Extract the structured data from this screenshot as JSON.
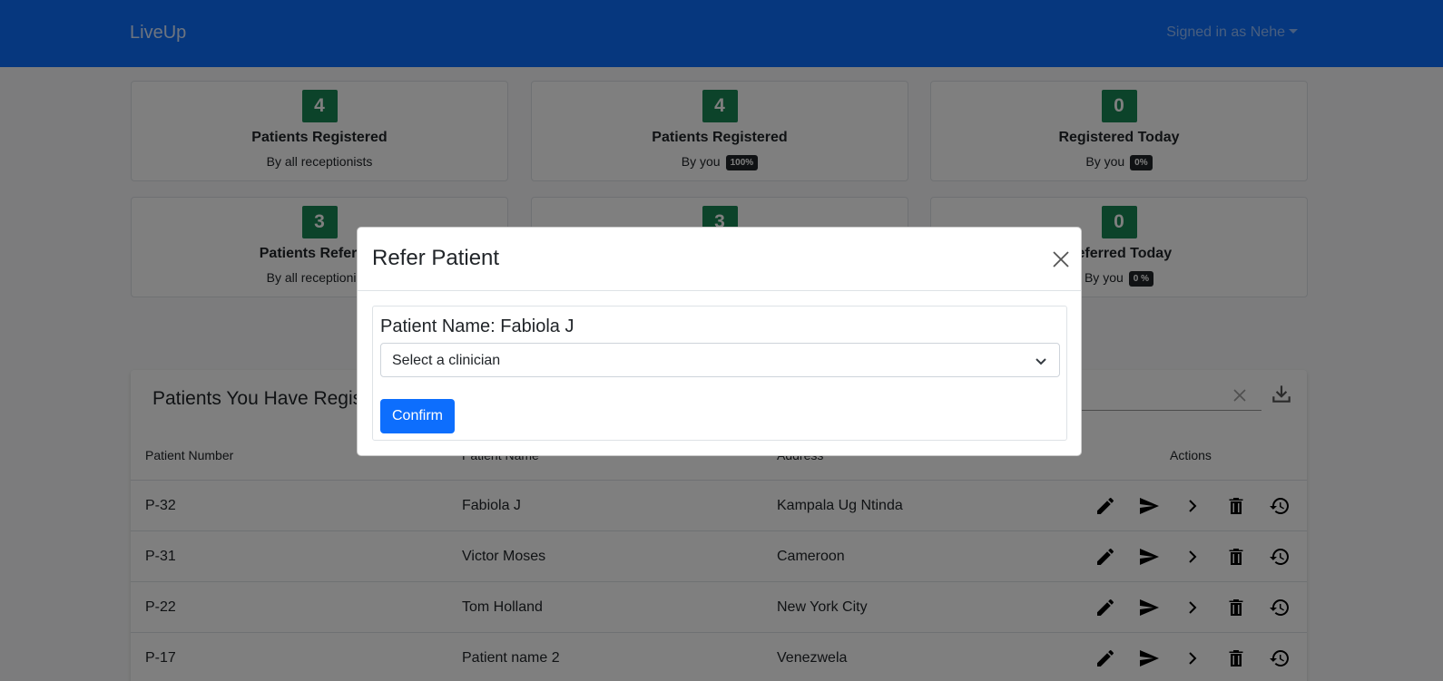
{
  "navbar": {
    "brand": "LiveUp",
    "user": "Signed in as Nehe"
  },
  "stats": [
    {
      "count": "4",
      "title": "Patients Registered",
      "subtitle": "By all receptionists",
      "badge": ""
    },
    {
      "count": "4",
      "title": "Patients Registered",
      "subtitle": "By you",
      "badge": "100%"
    },
    {
      "count": "0",
      "title": "Registered Today",
      "subtitle": "By you",
      "badge": "0%"
    },
    {
      "count": "3",
      "title": "Patients Referred",
      "subtitle": "By all receptionists",
      "badge": ""
    },
    {
      "count": "3",
      "title": "",
      "subtitle": "",
      "badge": ""
    },
    {
      "count": "0",
      "title": "Referred Today",
      "subtitle": "By you",
      "badge": "0 %"
    }
  ],
  "table": {
    "title": "Patients You Have Registered",
    "headers": [
      "Patient Number",
      "Patient Name",
      "Address",
      "Actions"
    ],
    "rows": [
      {
        "number": "P-32",
        "name": "Fabiola J",
        "address": "Kampala Ug Ntinda"
      },
      {
        "number": "P-31",
        "name": "Victor Moses",
        "address": "Cameroon"
      },
      {
        "number": "P-22",
        "name": "Tom Holland",
        "address": "New York City"
      },
      {
        "number": "P-17",
        "name": "Patient name 2",
        "address": "Venezwela"
      }
    ]
  },
  "modal": {
    "title": "Refer Patient",
    "patient_label": "Patient Name: Fabiola J",
    "select_placeholder": "Select a clinician",
    "confirm_label": "Confirm"
  },
  "colors": {
    "primary": "#0d6efd",
    "success": "#198754",
    "dark": "#212529"
  },
  "icons": [
    "close-icon",
    "download-icon",
    "edit-icon",
    "send-icon",
    "chevron-right-icon",
    "delete-icon",
    "history-icon",
    "chevron-down-icon"
  ]
}
